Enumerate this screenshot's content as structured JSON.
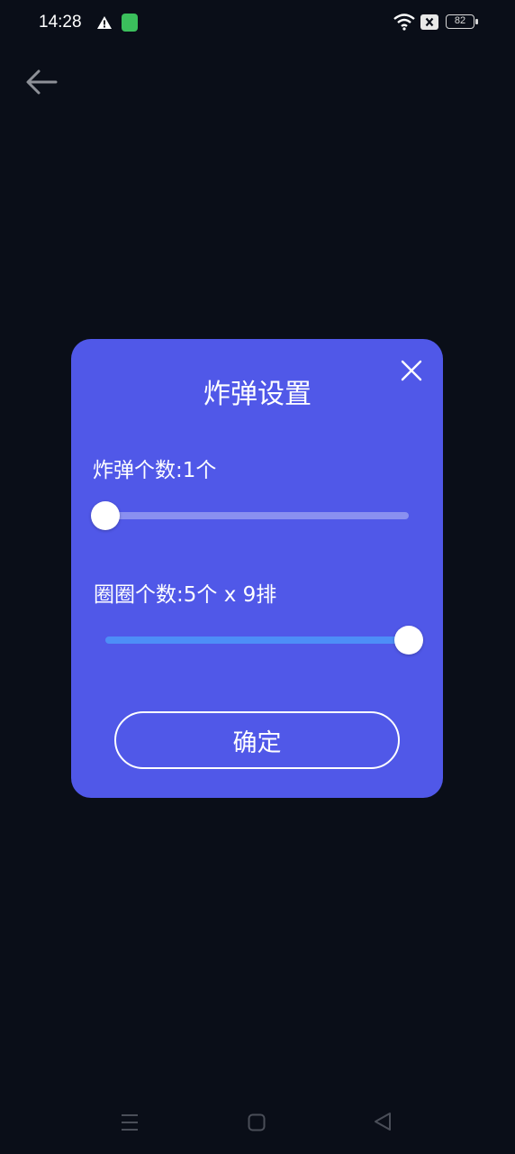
{
  "status_bar": {
    "time": "14:28",
    "battery": "82",
    "icons": [
      "warning-icon",
      "app-notification-icon",
      "wifi-icon",
      "sim-x-icon",
      "battery-icon"
    ]
  },
  "nav": {
    "back_icon": "arrow-left-icon"
  },
  "dialog": {
    "title": "炸弹设置",
    "close_icon": "close-icon",
    "bomb_label": "炸弹个数:1个",
    "bomb_slider": {
      "value": 1,
      "fill_fraction": 0.0
    },
    "ring_label": "圈圈个数:5个 x 9排",
    "ring_slider": {
      "fill_fraction": 1.0
    },
    "confirm_label": "确定"
  },
  "colors": {
    "background": "#0a0e18",
    "dialog": "#5058e8",
    "track_inactive": "#8a90f0",
    "track_active": "#4d8ef7"
  },
  "system_nav": [
    "menu-icon",
    "home-icon",
    "back-triangle-icon"
  ]
}
